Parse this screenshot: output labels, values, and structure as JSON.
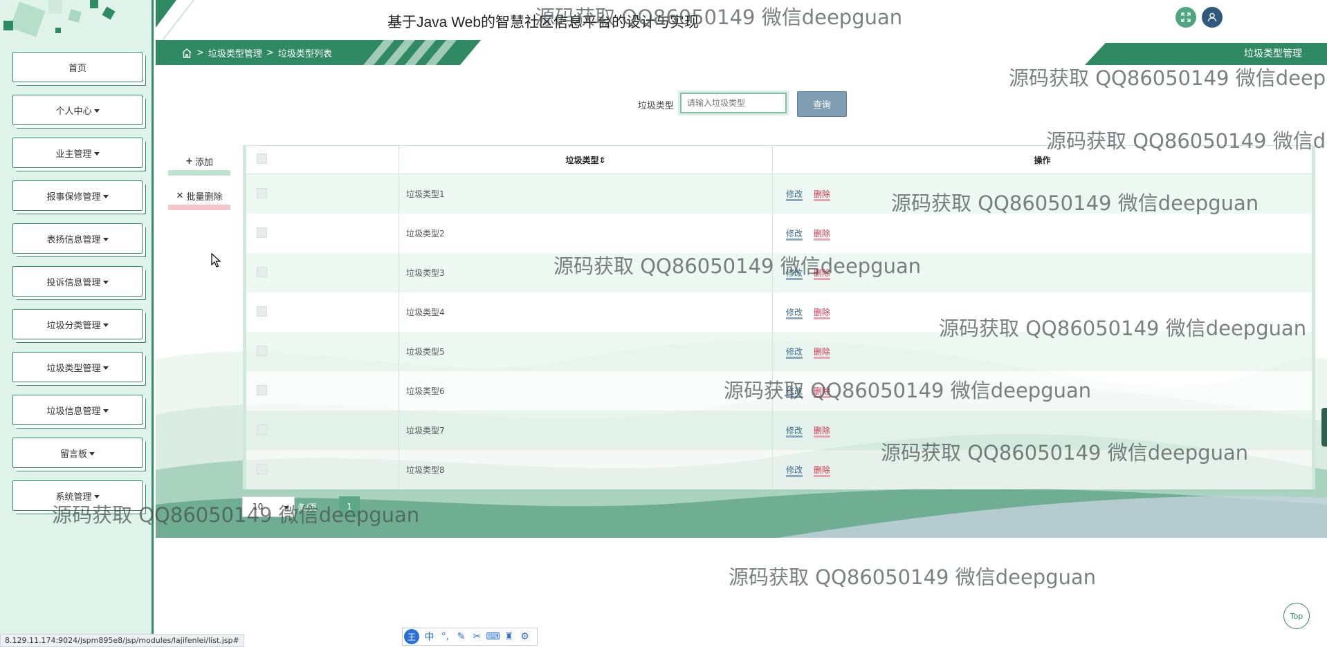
{
  "app": {
    "title": "基于Java Web的智慧社区信息平台的设计与实现"
  },
  "sidebar": {
    "items": [
      {
        "label": "首页",
        "has_caret": false
      },
      {
        "label": "个人中心",
        "has_caret": true
      },
      {
        "label": "业主管理",
        "has_caret": true
      },
      {
        "label": "报事保修管理",
        "has_caret": true
      },
      {
        "label": "表扬信息管理",
        "has_caret": true
      },
      {
        "label": "投诉信息管理",
        "has_caret": true
      },
      {
        "label": "垃圾分类管理",
        "has_caret": true
      },
      {
        "label": "垃圾类型管理",
        "has_caret": true
      },
      {
        "label": "垃圾信息管理",
        "has_caret": true
      },
      {
        "label": "留言板",
        "has_caret": true
      },
      {
        "label": "系统管理",
        "has_caret": true
      }
    ]
  },
  "breadcrumb": {
    "separator": ">",
    "level1": "垃圾类型管理",
    "level2": "垃圾类型列表"
  },
  "page_tag": "垃圾类型管理",
  "search": {
    "label": "垃圾类型",
    "placeholder": "请输入垃圾类型",
    "button": "查询"
  },
  "actions": {
    "add": "添加",
    "batch_delete": "批量删除"
  },
  "table": {
    "headers": {
      "type": "垃圾类型",
      "ops": "操作"
    },
    "edit_label": "修改",
    "delete_label": "删除",
    "rows": [
      "垃圾类型1",
      "垃圾类型2",
      "垃圾类型3",
      "垃圾类型4",
      "垃圾类型5",
      "垃圾类型6",
      "垃圾类型7",
      "垃圾类型8"
    ]
  },
  "pagination": {
    "page_size": "10",
    "unit": "条/页",
    "current_page": "1"
  },
  "watermark": "源码获取 QQ86050149 微信deepguan",
  "status_url": "8.129.11.174:9024/jspm895e8/jsp/modules/lajifenlei/list.jsp#",
  "top_button": "Top",
  "colors": {
    "primary": "#2f8a63",
    "sidebar_bg": "#dff3ea",
    "search_button": "#7f9eb3",
    "delete": "#d0314a"
  }
}
